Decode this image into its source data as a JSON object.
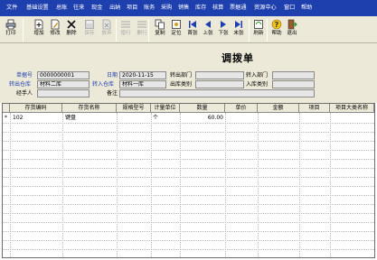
{
  "menubar": {
    "items": [
      "文件",
      "基础设置",
      "总账",
      "往来",
      "现金",
      "出纳",
      "项目",
      "账务",
      "采购",
      "销售",
      "库存",
      "核算",
      "票据通",
      "资源中心",
      "窗口",
      "帮助"
    ]
  },
  "toolbar": {
    "buttons": [
      {
        "label": "打印",
        "icon": "printer-icon",
        "enabled": true
      },
      {
        "label": "增加",
        "icon": "add-icon",
        "enabled": true
      },
      {
        "label": "修改",
        "icon": "edit-icon",
        "enabled": true
      },
      {
        "label": "删除",
        "icon": "delete-icon",
        "enabled": true
      },
      {
        "label": "保存",
        "icon": "save-icon",
        "enabled": false
      },
      {
        "label": "放弃",
        "icon": "discard-icon",
        "enabled": false
      },
      {
        "label": "增行",
        "icon": "add-row-icon",
        "enabled": false
      },
      {
        "label": "删行",
        "icon": "delete-row-icon",
        "enabled": false
      },
      {
        "label": "复制",
        "icon": "copy-icon",
        "enabled": true
      },
      {
        "label": "定位",
        "icon": "locate-icon",
        "enabled": true
      },
      {
        "label": "首张",
        "icon": "first-icon",
        "enabled": true
      },
      {
        "label": "上张",
        "icon": "prev-icon",
        "enabled": true
      },
      {
        "label": "下张",
        "icon": "next-icon",
        "enabled": true
      },
      {
        "label": "末张",
        "icon": "last-icon",
        "enabled": true
      },
      {
        "label": "刷新",
        "icon": "refresh-icon",
        "enabled": true
      },
      {
        "label": "帮助",
        "icon": "help-icon",
        "enabled": true
      },
      {
        "label": "退出",
        "icon": "exit-icon",
        "enabled": true
      }
    ]
  },
  "form": {
    "title": "调拨单",
    "doc_no_label": "单据号",
    "doc_no": "0000000001",
    "date_label": "日期",
    "date": "2020-11-15",
    "out_dept_label": "转出部门",
    "out_dept": "",
    "in_dept_label": "转入部门",
    "in_dept": "",
    "out_wh_label": "转出仓库",
    "out_wh": "材料二库",
    "in_wh_label": "转入仓库",
    "in_wh": "材料一库",
    "out_type_label": "出库类别",
    "out_type": "",
    "in_type_label": "入库类别",
    "in_type": "",
    "handler_label": "经手人",
    "handler": "",
    "remark_label": "备注",
    "remark": ""
  },
  "grid": {
    "headers": [
      "存货编码",
      "存货名称",
      "规格型号",
      "计量单位",
      "数量",
      "单价",
      "金额",
      "项目",
      "项目大类名称"
    ],
    "rows": [
      {
        "marker": "*",
        "code": "102",
        "name": "键盘",
        "spec": "",
        "unit": "个",
        "qty": "60.00",
        "price": "",
        "amount": "",
        "project": "",
        "category": ""
      }
    ]
  },
  "colors": {
    "menubar": "#1e3fae",
    "label_blue": "#1e3fae",
    "chrome": "#ece9d8"
  }
}
